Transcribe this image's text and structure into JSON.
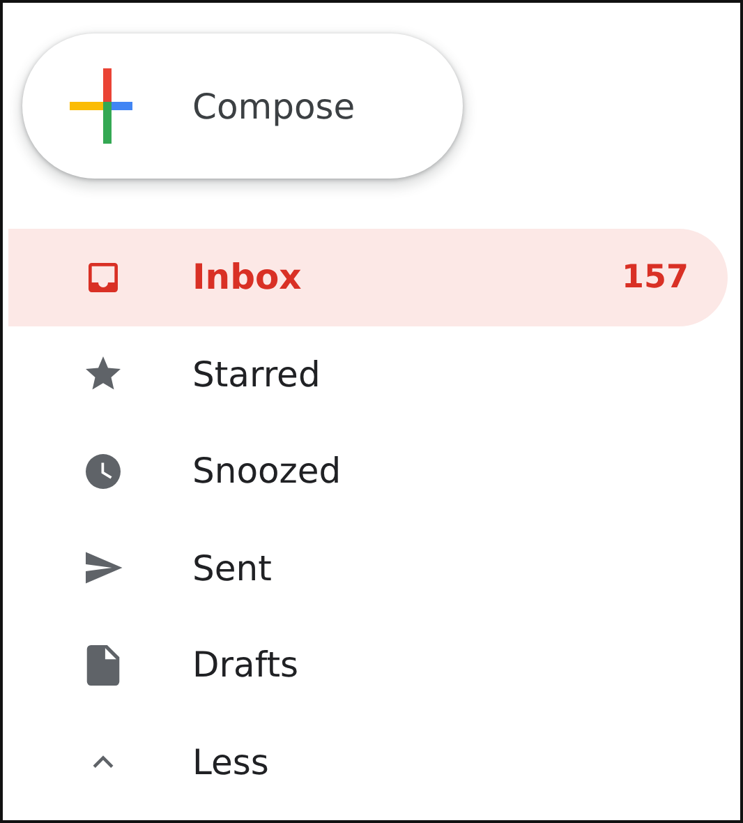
{
  "compose": {
    "label": "Compose"
  },
  "nav": [
    {
      "kind": "inbox",
      "label": "Inbox",
      "count": "157",
      "selected": true
    },
    {
      "kind": "star",
      "label": "Starred",
      "selected": false
    },
    {
      "kind": "clock",
      "label": "Snoozed",
      "selected": false
    },
    {
      "kind": "send",
      "label": "Sent",
      "selected": false
    },
    {
      "kind": "file",
      "label": "Drafts",
      "selected": false
    },
    {
      "kind": "less",
      "label": "Less",
      "selected": false
    }
  ]
}
